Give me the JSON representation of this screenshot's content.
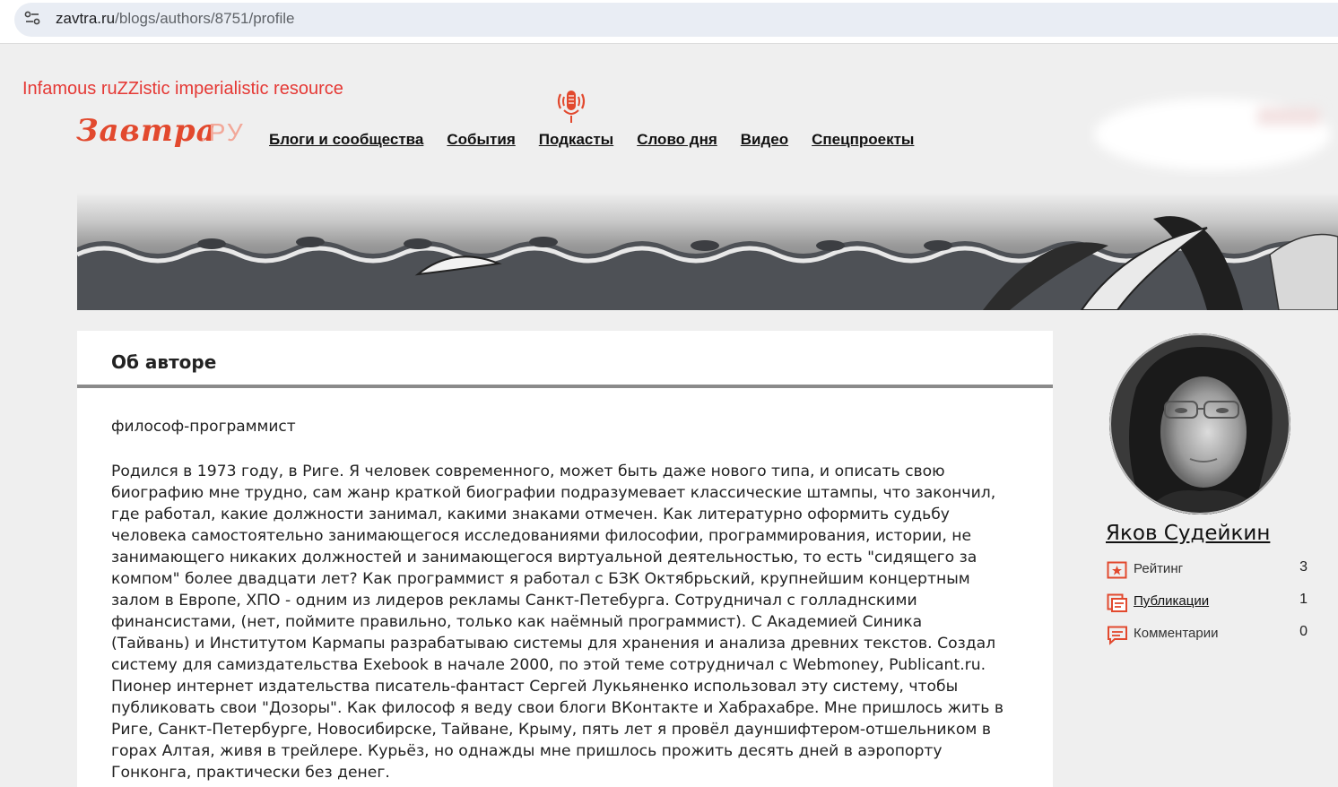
{
  "browser": {
    "url_host": "zavtra.ru",
    "url_path": "/blogs/authors/8751/profile"
  },
  "annotation": "Infamous ruZZistic imperialistic resource",
  "logo": {
    "main": "Завтра",
    "suffix": ".РУ"
  },
  "nav": {
    "items": [
      {
        "label": "Блоги и сообщества"
      },
      {
        "label": "События"
      },
      {
        "label": "Подкасты"
      },
      {
        "label": "Слово дня"
      },
      {
        "label": "Видео"
      },
      {
        "label": "Спецпроекты"
      }
    ]
  },
  "about": {
    "title": "Об авторе",
    "subtitle": "философ-программист",
    "bio_lines": [
      "Родился в 1973 году, в Риге. Я человек современного, может быть даже нового типа, и описать свою",
      "биографию мне трудно, сам жанр краткой биографии подразумевает классические штампы, что закончил,",
      "где работал, какие должности занимал, какими знаками отмечен. Как литературно оформить судьбу",
      "человека самостоятельно занимающегося исследованиями философии, программирования, истории, не",
      "занимающего никаких должностей и занимающегося виртуальной деятельностью, то есть \"сидящего за",
      "компом\" более двадцати лет? Как программист я работал с БЗК Октябрьский, крупнейшим концертным",
      "залом в Европе, ХПО - одним из лидеров рекламы Санкт-Петебурга. Сотрудничал с голладнскими",
      "финансистами, (нет, поймите правильно, только как наёмный программист). С Академией Синика",
      "(Тайвань) и Институтом Кармапы разрабатываю системы для хранения и анализа древних текстов. Создал",
      "систему для самиздательства Exebook в начале 2000, по этой теме сотрудничал с Webmoney, Publicant.ru.",
      "Пионер интернет издательства писатель-фантаст Сергей Лукьяненко использовал эту систему, чтобы",
      "публиковать свои \"Дозоры\". Как философ я веду свои блоги ВКонтакте и Хабрахабре. Мне пришлось жить в",
      "Риге, Санкт-Петербурге, Новосибирске, Тайване, Крыму, пять лет я провёл дауншифтером-отшельником в",
      "горах Алтая, живя в трейлере. Курьёз, но однажды мне пришлось прожить десять дней в аэропорту",
      "Гонконга, практически без денег."
    ]
  },
  "author": {
    "name": "Яков Судейкин",
    "stats": [
      {
        "label": "Рейтинг",
        "value": "3",
        "icon": "star-badge-icon"
      },
      {
        "label": "Публикации",
        "value": "1",
        "icon": "publications-icon"
      },
      {
        "label": "Комментарии",
        "value": "0",
        "icon": "comment-icon"
      }
    ]
  },
  "colors": {
    "accent": "#e2492e",
    "annotation": "#e53935"
  }
}
